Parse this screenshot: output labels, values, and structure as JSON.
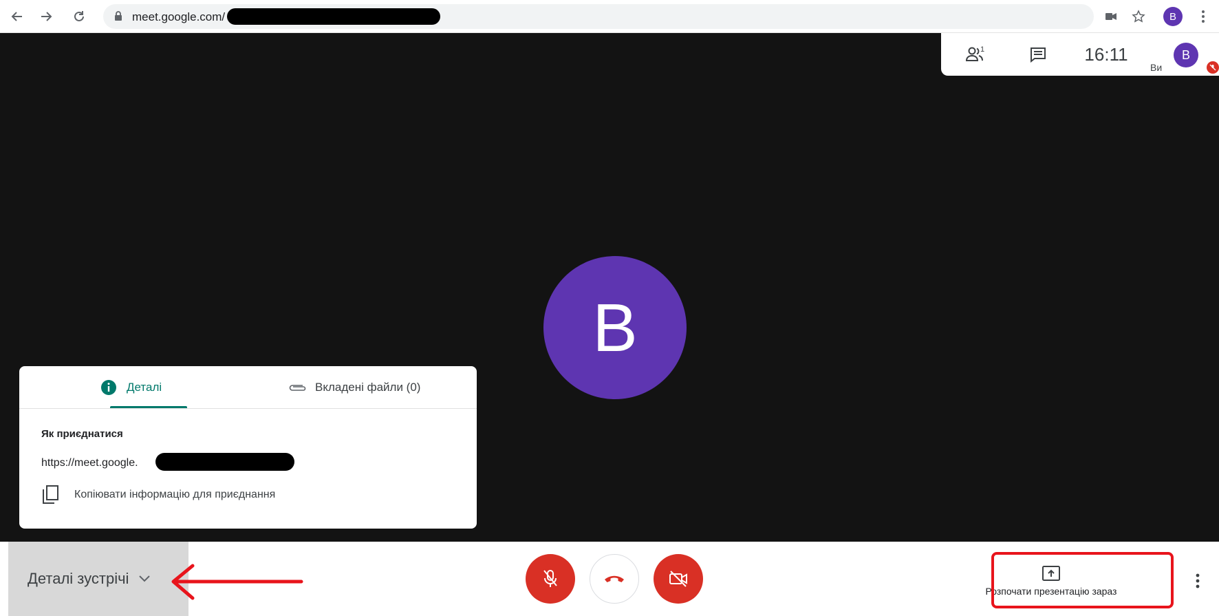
{
  "browser": {
    "url_text": "meet.google.com/",
    "profile_initial": "B"
  },
  "meeting": {
    "clock": "16:11",
    "participant_count": "1",
    "you_label": "Ви",
    "self_initial": "B",
    "main_avatar_initial": "B"
  },
  "details_card": {
    "tabs": [
      {
        "label": "Деталі",
        "active": true
      },
      {
        "label": "Вкладені файли (0)",
        "active": false
      }
    ],
    "join_title": "Як приєднатися",
    "join_link": "https://meet.google.",
    "copy_label": "Копіювати інформацію для приєднання"
  },
  "bottom_bar": {
    "details_toggle_label": "Деталі зустрічі",
    "present_label": "Розпочати презентацію зараз"
  },
  "colors": {
    "accent_teal": "#00796b",
    "danger_red": "#d93025",
    "avatar_purple": "#5e35b1",
    "annotation_red": "#e8141c",
    "stage_bg": "#131313"
  },
  "icons": [
    "back-arrow-icon",
    "forward-arrow-icon",
    "reload-icon",
    "lock-icon",
    "camera-icon",
    "star-icon",
    "chrome-menu-icon",
    "people-icon",
    "chat-icon",
    "mic-off-icon",
    "info-icon",
    "attachment-icon",
    "copy-icon",
    "chevron-down-icon",
    "mic-off-button-icon",
    "hangup-icon",
    "camera-off-icon",
    "present-screen-icon",
    "more-vert-icon"
  ]
}
